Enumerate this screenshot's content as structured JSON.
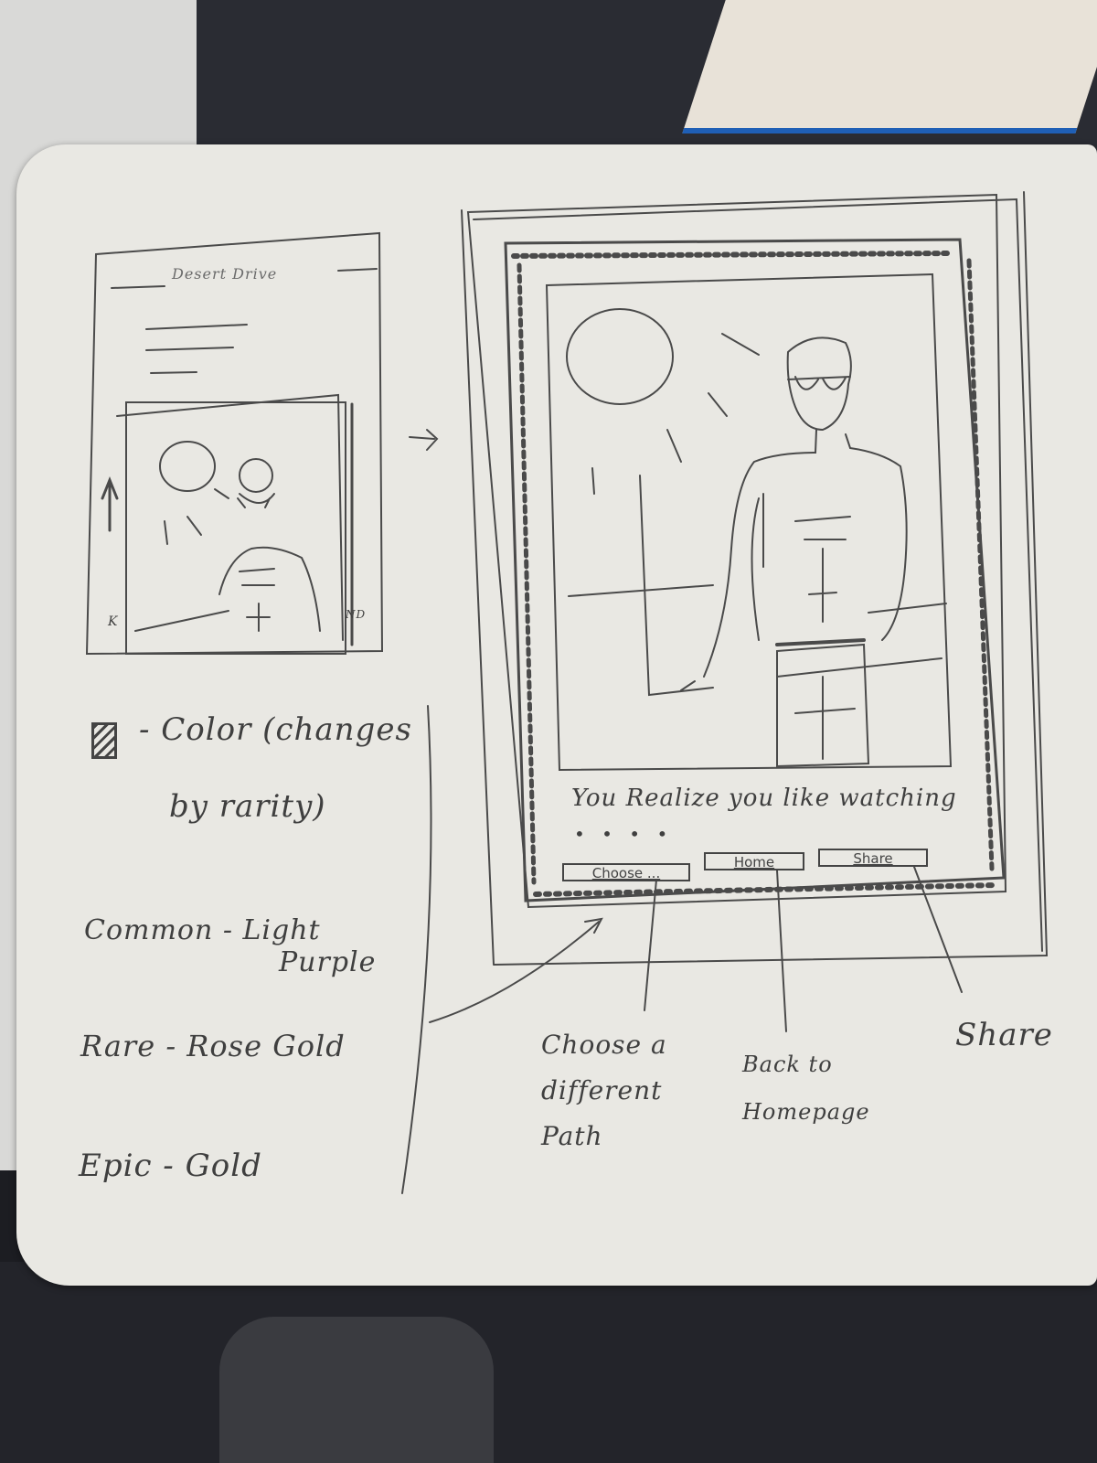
{
  "small_screen": {
    "title": "Desert Drive",
    "corner_left": "K",
    "corner_right": "ND"
  },
  "arrow_symbol": "->",
  "legend": {
    "line1": "- Color (changes",
    "line2": "by rarity)",
    "common_label": "Common - Light",
    "common_color_cont": "Purple",
    "rare": "Rare - Rose Gold",
    "epic": "Epic - Gold",
    "swatch_icon": "hatched-square-icon"
  },
  "card": {
    "caption": "You Realize you like watching",
    "progress_dots": "• • • •",
    "buttons": {
      "choose": "Choose ...",
      "home": "Home",
      "share": "Share"
    }
  },
  "annotations": {
    "choose": "Choose a different Path",
    "home": "Back to Homepage",
    "share": "Share"
  },
  "colors": {
    "paper": "#e9e8e3",
    "pencil": "#3f3f3f"
  }
}
